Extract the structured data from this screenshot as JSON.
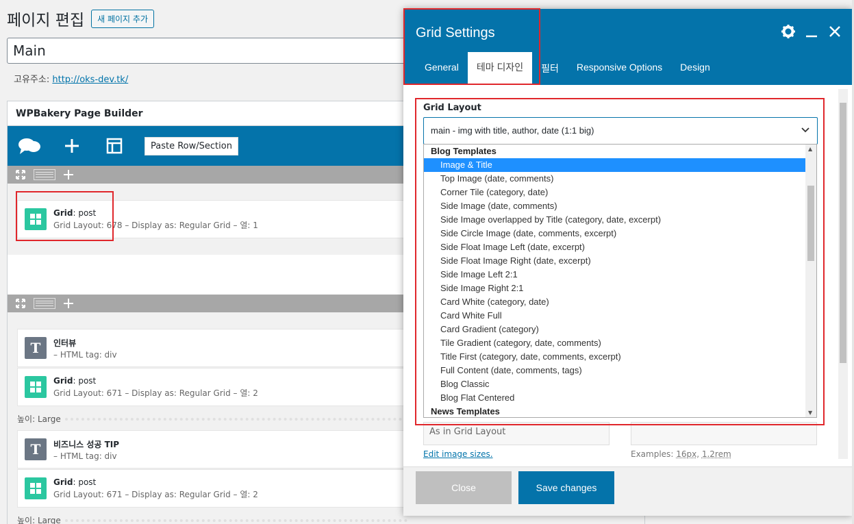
{
  "editor": {
    "heading": "페이지 편집",
    "add_new": "새 페이지 추가",
    "title_value": "Main",
    "permalink_label": "고유주소:",
    "permalink_url": "http://oks-dev.tk/",
    "builder_title": "WPBakery Page Builder",
    "paste_row": "Paste Row/Section",
    "blocks": [
      {
        "type": "grid",
        "name": "Grid",
        "value": "post",
        "meta": "Grid Layout: 678  –  Display as: Regular Grid  –  열: 1"
      },
      {
        "type": "text",
        "name": "인터뷰",
        "meta": "–  HTML tag: div"
      },
      {
        "type": "grid",
        "name": "Grid",
        "value": "post",
        "meta": "Grid Layout: 671  –  Display as: Regular Grid  –  열: 2"
      },
      {
        "type": "text",
        "name": "비즈니스 성공 TIP",
        "meta": "–  HTML tag: div"
      },
      {
        "type": "grid",
        "name": "Grid",
        "value": "post",
        "meta": "Grid Layout: 671  –  Display as: Regular Grid  –  열: 2"
      }
    ],
    "height_label": "높이: Large"
  },
  "modal": {
    "title": "Grid Settings",
    "tabs": [
      "General",
      "테마 디자인",
      "필터",
      "Responsive Options",
      "Design"
    ],
    "active_tab": 1,
    "field_label": "Grid Layout",
    "selected_value": "main - img with title, author, date (1:1 big)",
    "groups": [
      {
        "label": "Blog Templates",
        "options": [
          "Image & Title",
          "Top Image (date, comments)",
          "Corner Tile (category, date)",
          "Side Image (date, comments)",
          "Side Image overlapped by Title (category, date, excerpt)",
          "Side Circle Image (date, comments, excerpt)",
          "Side Float Image Left (date, excerpt)",
          "Side Float Image Right (date, excerpt)",
          "Side Image Left 2:1",
          "Side Image Right 2:1",
          "Card White (category, date)",
          "Card White Full",
          "Card Gradient (category)",
          "Tile Gradient (category, date, comments)",
          "Title First (category, date, comments, excerpt)",
          "Full Content (date, comments, tags)",
          "Blog Classic",
          "Blog Flat Centered"
        ]
      },
      {
        "label": "News Templates",
        "options": []
      }
    ],
    "highlighted_option": "Image & Title",
    "behind_select": "As in Grid Layout",
    "edit_sizes": "Edit image sizes.",
    "examples_prefix": "Examples:",
    "examples_a": "16px",
    "examples_b": "1.2rem",
    "close": "Close",
    "save": "Save changes"
  },
  "colors": {
    "brand": "#0473aa",
    "grid_icon": "#2bc7a0",
    "highlight": "#1e90ff",
    "annotation": "#e0262b"
  }
}
